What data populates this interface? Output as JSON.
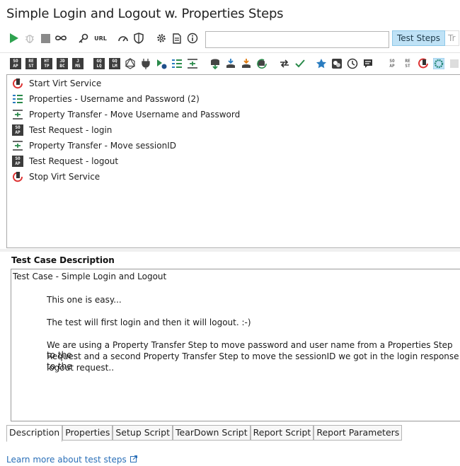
{
  "window": {
    "title": "Simple Login and Logout w. Properties Steps"
  },
  "toolbar": {
    "url_label": "URL",
    "search_placeholder": "",
    "tabs": [
      {
        "label": "Test Steps"
      },
      {
        "label": "Tr"
      }
    ]
  },
  "steps_toolbar": {
    "icons": [
      {
        "lines": [
          "SO",
          "AP"
        ]
      },
      {
        "lines": [
          "RE",
          "ST"
        ]
      },
      {
        "lines": [
          "HT",
          "TP"
        ]
      },
      {
        "lines": [
          "JD",
          "BC"
        ]
      },
      {
        "lines": [
          "J",
          "MS"
        ]
      },
      {
        "lines": [
          "GQ",
          "LQ"
        ]
      },
      {
        "lines": [
          "GQ",
          "LM"
        ]
      }
    ],
    "right_icons": [
      {
        "lines": [
          "SO",
          "AP"
        ]
      },
      {
        "lines": [
          "RE",
          "ST"
        ]
      }
    ]
  },
  "steps": [
    {
      "label": "Start Virt Service",
      "icon": "virt-service-icon"
    },
    {
      "label": "Properties - Username and Password (2)",
      "icon": "properties-icon"
    },
    {
      "label": "Property Transfer - Move Username and Password",
      "icon": "property-transfer-icon"
    },
    {
      "label": "Test Request - login",
      "icon": "soap-request-icon",
      "lines": [
        "SO",
        "AP"
      ]
    },
    {
      "label": "Property Transfer - Move sessionID",
      "icon": "property-transfer-icon"
    },
    {
      "label": "Test Request - logout",
      "icon": "soap-request-icon",
      "lines": [
        "SO",
        "AP"
      ]
    },
    {
      "label": "Stop Virt Service",
      "icon": "virt-service-icon"
    }
  ],
  "description": {
    "label": "Test Case Description",
    "line1": "Test Case - Simple Login and Logout",
    "line2": "This one is easy...",
    "line3": "The test will first login and then it will logout. :-)",
    "line4a": "We are using a Property Transfer Step to move password and user name from a Properties Step to the",
    "line4b": "Request and a second Property Transfer Step to move the sessionID we got in the login response to the",
    "line4c": "logout request.."
  },
  "bottom_tabs": [
    {
      "label": "Description",
      "active": true
    },
    {
      "label": "Properties"
    },
    {
      "label": "Setup Script"
    },
    {
      "label": "TearDown Script"
    },
    {
      "label": "Report Script"
    },
    {
      "label": "Report Parameters"
    }
  ],
  "footer": {
    "learn_more": "Learn more about test steps"
  }
}
